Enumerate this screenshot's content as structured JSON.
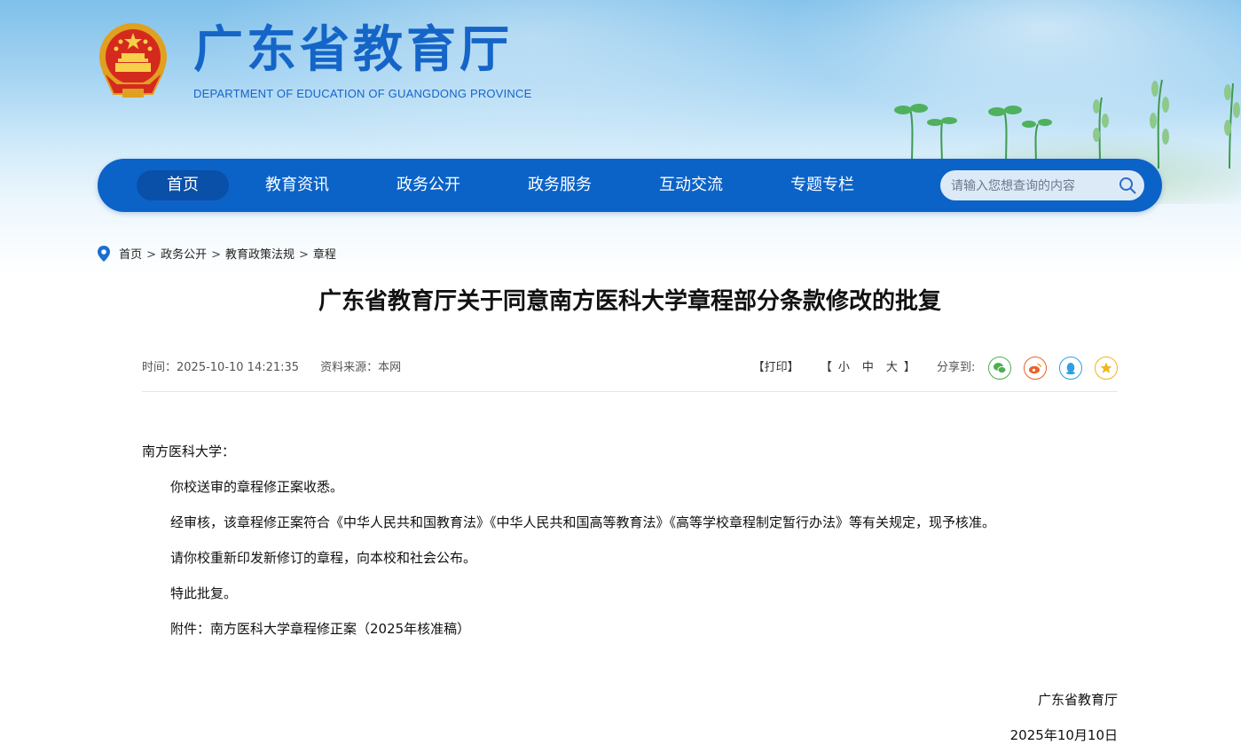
{
  "header": {
    "site_title": "广东省教育厅",
    "site_subtitle": "DEPARTMENT OF EDUCATION OF GUANGDONG PROVINCE"
  },
  "nav": {
    "items": [
      {
        "label": "首页",
        "active": true
      },
      {
        "label": "教育资讯"
      },
      {
        "label": "政务公开"
      },
      {
        "label": "政务服务"
      },
      {
        "label": "互动交流"
      },
      {
        "label": "专题专栏"
      }
    ],
    "search_placeholder": "请输入您想查询的内容"
  },
  "breadcrumb": [
    "首页",
    "政务公开",
    "教育政策法规",
    "章程"
  ],
  "breadcrumb_sep": ">",
  "article": {
    "title": "广东省教育厅关于同意南方医科大学章程部分条款修改的批复",
    "meta": {
      "time": "时间：2025-10-10 14:21:35",
      "source": "资料来源：本网"
    },
    "controls": {
      "print": "【打印】",
      "font_open": "【",
      "font_small": "小",
      "font_medium": "中",
      "font_large": "大",
      "font_close": "】",
      "share_label": "分享到:"
    },
    "salutation": "南方医科大学：",
    "paragraphs": [
      "你校送审的章程修正案收悉。",
      "经审核，该章程修正案符合《中华人民共和国教育法》《中华人民共和国高等教育法》《高等学校章程制定暂行办法》等有关规定，现予核准。",
      "请你校重新印发新修订的章程，向本校和社会公布。",
      "特此批复。",
      "附件：南方医科大学章程修正案（2025年核准稿）"
    ],
    "signature": "广东省教育厅",
    "date": "2025年10月10日"
  },
  "colors": {
    "brand_blue": "#0b63c8",
    "title_blue": "#1565c8",
    "wechat": "#4caf50",
    "weibo": "#e8612c",
    "qq": "#2e9ee6",
    "favorite": "#f2b51c"
  },
  "icons": [
    "national-emblem-icon",
    "search-icon",
    "location-pin-icon",
    "wechat-icon",
    "weibo-icon",
    "qq-icon",
    "favorite-star-icon"
  ]
}
